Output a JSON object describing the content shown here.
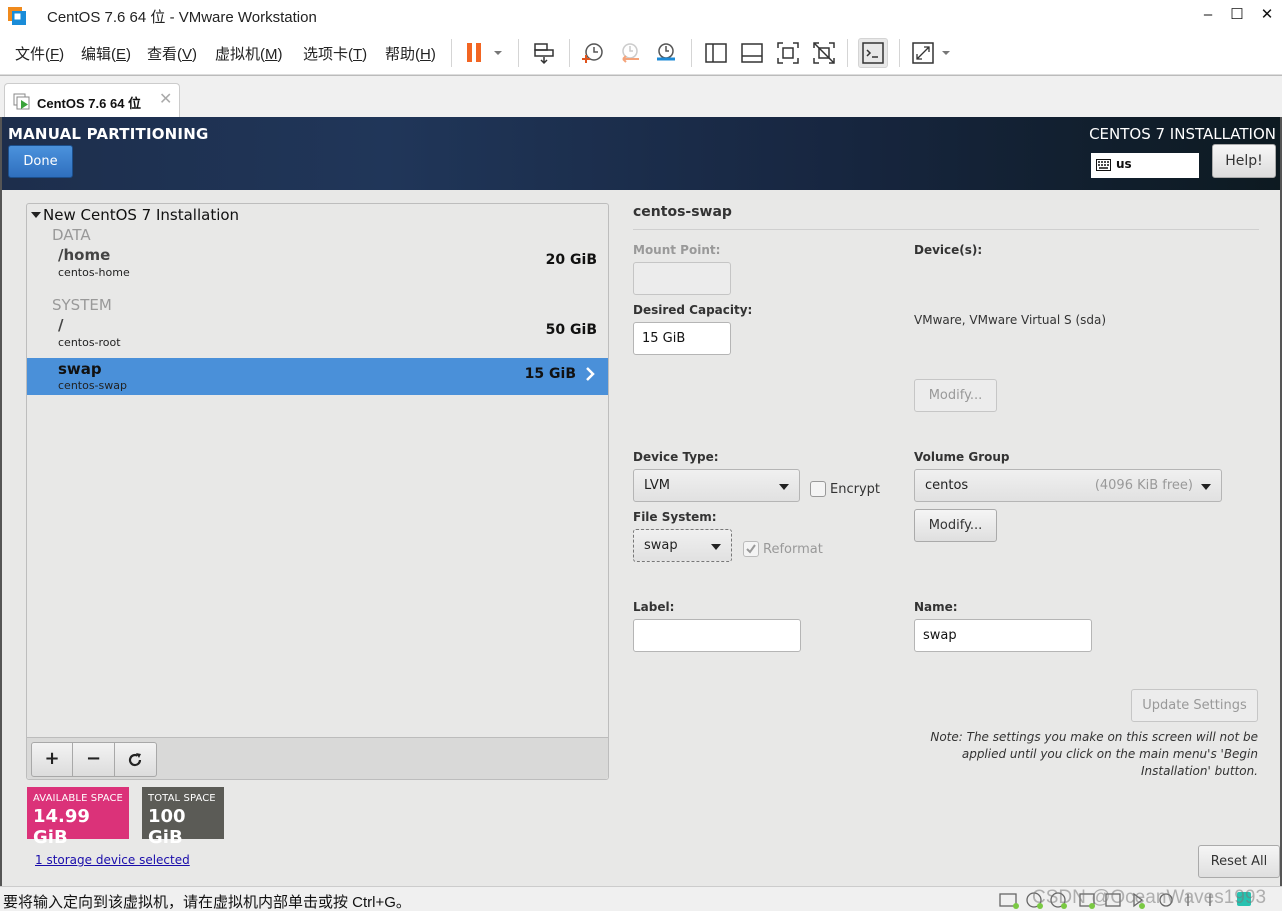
{
  "window": {
    "title": "CentOS 7.6 64 位 - VMware Workstation",
    "minimize_glyph": "–",
    "maximize_glyph": "☐",
    "close_glyph": "✕"
  },
  "menu": [
    {
      "label": "文件(",
      "key": "F",
      "end": ")"
    },
    {
      "label": "编辑(",
      "key": "E",
      "end": ")"
    },
    {
      "label": "查看(",
      "key": "V",
      "end": ")"
    },
    {
      "label": "虚拟机(",
      "key": "M",
      "end": ")"
    },
    {
      "label": "选项卡(",
      "key": "T",
      "end": ")"
    },
    {
      "label": "帮助(",
      "key": "H",
      "end": ")"
    }
  ],
  "toolbar_icons": [
    "pause-icon",
    "send-ctrl-alt-del-icon",
    "snapshot-icon",
    "revert-snapshot-icon",
    "snapshot-manager-icon",
    "library-view-icon",
    "thumbnail-view-icon",
    "fullscreen-icon",
    "unity-icon",
    "console-view-icon",
    "stretch-view-icon"
  ],
  "tab": {
    "label": "CentOS 7.6 64 位",
    "close_glyph": "✕"
  },
  "anaconda": {
    "spoke_title": "MANUAL PARTITIONING",
    "done_label": "Done",
    "product_title": "CENTOS 7 INSTALLATION",
    "keyboard_layout": "us",
    "help_label": "Help!"
  },
  "partitions": {
    "root_label": "New CentOS 7 Installation",
    "groups": [
      {
        "name": "DATA",
        "items": [
          {
            "mount": "/home",
            "device": "centos-home",
            "size": "20 GiB",
            "selected": false
          }
        ]
      },
      {
        "name": "SYSTEM",
        "items": [
          {
            "mount": "/",
            "device": "centos-root",
            "size": "50 GiB",
            "selected": false
          },
          {
            "mount": "swap",
            "device": "centos-swap",
            "size": "15 GiB",
            "selected": true
          }
        ]
      }
    ],
    "add_glyph": "+",
    "remove_glyph": "−",
    "refresh_glyph": "⟳"
  },
  "space": {
    "available_label": "AVAILABLE SPACE",
    "available_value": "14.99 GiB",
    "available_color": "#db3279",
    "total_label": "TOTAL SPACE",
    "total_value": "100 GiB",
    "total_color": "#5b5b56"
  },
  "storage_link": "1 storage device selected",
  "details": {
    "title": "centos-swap",
    "mount_point_label": "Mount Point:",
    "mount_point_value": "",
    "desired_capacity_label": "Desired Capacity:",
    "desired_capacity_value": "15 GiB",
    "devices_label": "Device(s):",
    "devices_value": "VMware, VMware Virtual S (sda)",
    "modify_devices_label": "Modify...",
    "device_type_label": "Device Type:",
    "device_type_value": "LVM",
    "encrypt_label": "Encrypt",
    "encrypt_checked": false,
    "file_system_label": "File System:",
    "file_system_value": "swap",
    "reformat_label": "Reformat",
    "reformat_checked": true,
    "volume_group_label": "Volume Group",
    "volume_group_value": "centos",
    "volume_group_free": "(4096 KiB free)",
    "modify_vg_label": "Modify...",
    "label_label": "Label:",
    "label_value": "",
    "name_label": "Name:",
    "name_value": "swap",
    "update_label": "Update Settings",
    "note": "Note:  The settings you make on this screen will not be applied until you click on the main menu's 'Begin Installation' button.",
    "reset_label": "Reset All"
  },
  "statusbar": {
    "message": "要将输入定向到该虚拟机，请在虚拟机内部单击或按 Ctrl+G。",
    "watermark": "CSDN @OceanWaves1993"
  }
}
